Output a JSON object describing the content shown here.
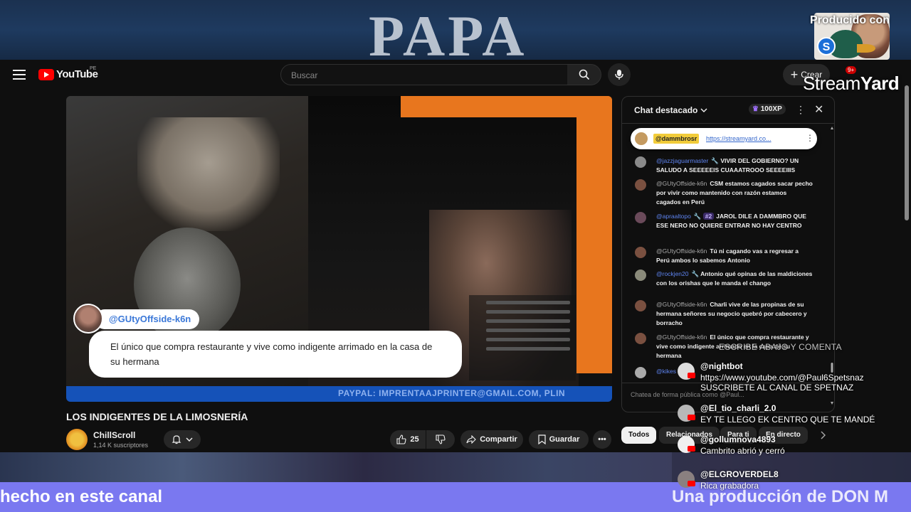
{
  "top_banner": {
    "headline": "PAPA",
    "producer_label": "Producido con"
  },
  "streamyard": {
    "brand_a": "Stream",
    "brand_b": "Yard"
  },
  "header": {
    "logo_text": "YouTube",
    "region": "PE",
    "search_placeholder": "Buscar",
    "create_label": "Crear",
    "notifications_badge": "9+"
  },
  "video": {
    "overlay_username": "@GUtyOffside-k6n",
    "overlay_message": "El único que compra restaurante y vive como indigente arrimado en la casa de su hermana",
    "bottom_ticker": "PAYPAL: IMPRENTAAJPRINTER@GMAIL.COM, PLIN",
    "title": "LOS INDIGENTES DE LA LIMOSNERÍA",
    "channel_name": "ChillScroll",
    "subscribers": "1,14 K suscriptores",
    "likes": "25",
    "share_label": "Compartir",
    "save_label": "Guardar"
  },
  "chat": {
    "title": "Chat destacado",
    "xp_badge": "100XP",
    "pinned_user": "@dammbrosr",
    "pinned_link": "https://streamyard.co...",
    "input_placeholder": "Chatea de forma pública como @Paul...",
    "messages": [
      {
        "user": "@jazzjaguarmaster",
        "mod": true,
        "rank": "",
        "text": "VIVIR DEL GOBIERNO? UN SALUDO A SEEEEEIS CUAAATROOO SEEEEIIIS"
      },
      {
        "user": "@GUtyOffside-k6n",
        "mod": false,
        "rank": "",
        "text": "CSM estamos cagados sacar pecho por vivir como mantenido con razón estamos cagados en Perú"
      },
      {
        "user": "@apraaltopo",
        "mod": true,
        "rank": "#2",
        "text": "JAROL DILE A DAMMBRO QUE ESE NERO NO QUIERE ENTRAR NO HAY CENTRO"
      },
      {
        "user": "@GUtyOffside-k6n",
        "mod": false,
        "rank": "",
        "text": "Tú ni cagando vas a regresar a Perú ambos lo sabemos Antonio"
      },
      {
        "user": "@rockjen20",
        "mod": true,
        "rank": "",
        "text": "Antonio qué opinas de las maldiciones con los orishas que le manda el chango"
      },
      {
        "user": "@GUtyOffside-k6n",
        "mod": false,
        "rank": "",
        "text": "Charli vive de las propinas de su hermana señores su negocio quebró por cabecero y borracho"
      },
      {
        "user": "@GUtyOffside-k6n",
        "mod": false,
        "rank": "",
        "text": "El único que compra restaurante y vive como indigente arrimado en la casa de su hermana"
      },
      {
        "user": "@kikes",
        "mod": true,
        "rank": "",
        "text": ""
      }
    ],
    "chips": [
      "Todos",
      "Relacionados",
      "Para ti",
      "En directo"
    ]
  },
  "stream_overlay": {
    "header": "ESCRIBE ABAJO Y COMENTA",
    "messages": [
      {
        "name": "@nightbot",
        "text": "https://www.youtube.com/@Paul6Spetsnaz\nSUSCRIBETE AL CANAL DE SPETNAZ"
      },
      {
        "name": "@El_tio_charli_2.0",
        "text": "EY TE LLEGO EK CENTRO QUE TE MANDÉ"
      },
      {
        "name": "@gollumnova4893",
        "text": "Cambrito abrió y cerró"
      },
      {
        "name": "@ELGROVERDEL8",
        "text": "Rica grabadora"
      }
    ]
  },
  "bottom_banner": {
    "left_text": "hecho en este canal",
    "right_text": "Una producción de DON M"
  }
}
